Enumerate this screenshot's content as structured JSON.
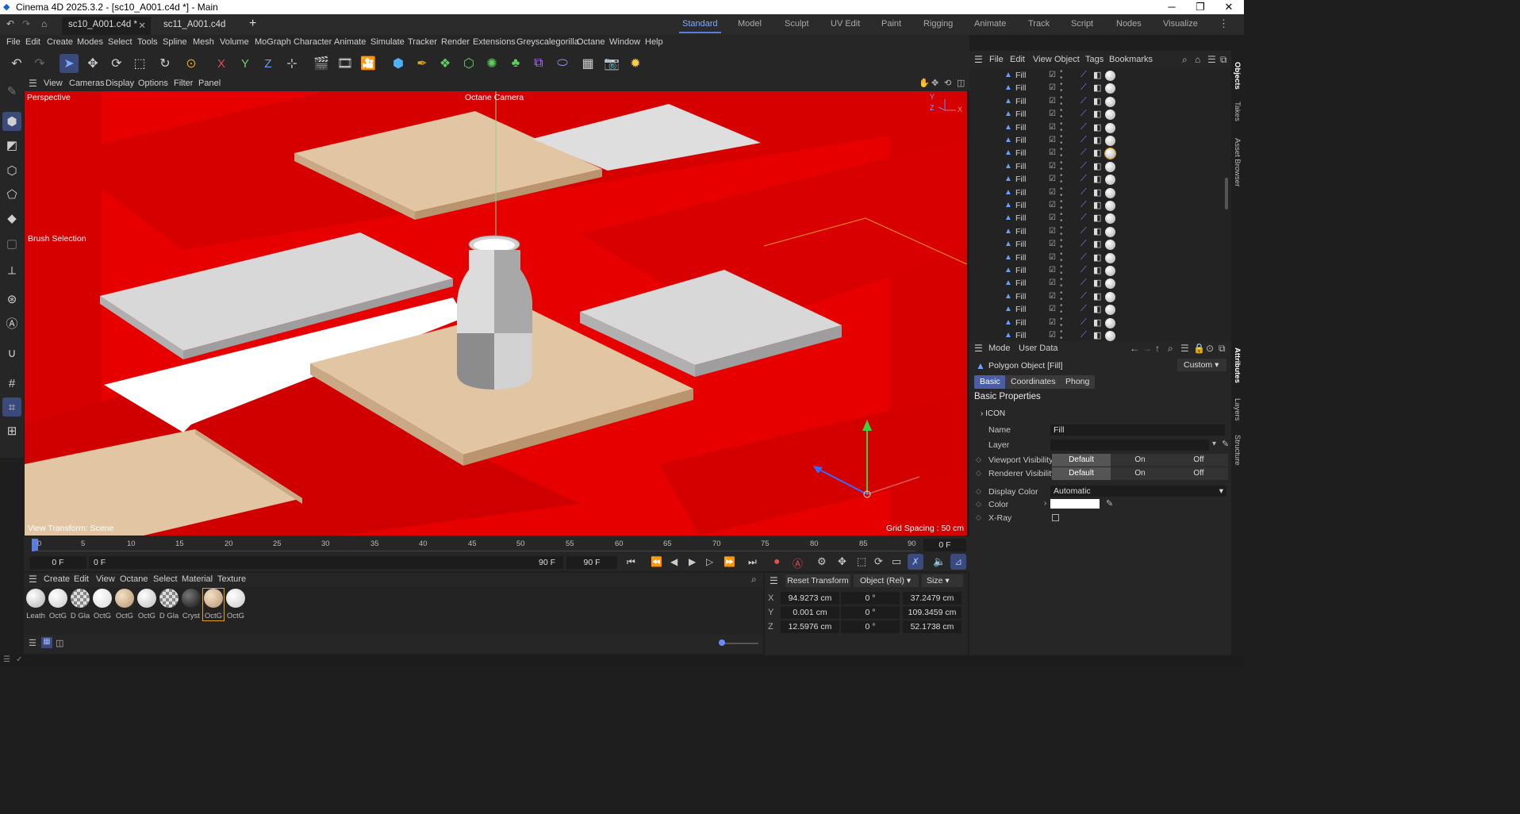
{
  "app": {
    "title": "Cinema 4D 2025.3.2 - [sc10_A001.c4d *] - Main"
  },
  "file_tabs": [
    {
      "label": "sc10_A001.c4d *"
    },
    {
      "label": "sc11_A001.c4d"
    }
  ],
  "layouts": [
    "Standard",
    "Model",
    "Sculpt",
    "UV Edit",
    "Paint",
    "Rigging",
    "Animate",
    "Track",
    "Script",
    "Nodes",
    "Visualize"
  ],
  "menus": [
    "File",
    "Edit",
    "Create",
    "Modes",
    "Select",
    "Tools",
    "Spline",
    "Mesh",
    "Volume",
    "MoGraph",
    "Character",
    "Animate",
    "Simulate",
    "Tracker",
    "Render",
    "Extensions",
    "Greyscalegorilla",
    "Octane",
    "Window",
    "Help"
  ],
  "toolbar": {
    "axes": [
      "X",
      "Y",
      "Z"
    ]
  },
  "viewport": {
    "menus": [
      "View",
      "Cameras",
      "Display",
      "Options",
      "Filter",
      "Panel"
    ],
    "view_name": "Perspective",
    "camera_label": "Octane Camera",
    "brush_label": "Brush Selection",
    "view_transform": "View Transform: Scene",
    "grid_spacing": "Grid Spacing : 50 cm",
    "axis_y": "Y",
    "axis_z": "Z",
    "axis_x": "X",
    "bg_color": "#e60000"
  },
  "timeline": {
    "ticks": [
      "0",
      "5",
      "10",
      "15",
      "20",
      "25",
      "30",
      "35",
      "40",
      "45",
      "50",
      "55",
      "60",
      "65",
      "70",
      "75",
      "80",
      "85",
      "90"
    ],
    "current": "0 F"
  },
  "playback": {
    "start": "0 F",
    "preview_start": "0 F",
    "preview_end": "90 F",
    "end": "90 F"
  },
  "materials": {
    "menus": [
      "Create",
      "Edit",
      "View",
      "Octane",
      "Select",
      "Material",
      "Texture"
    ],
    "items": [
      {
        "label": "Leath",
        "color": "#d8d8d8"
      },
      {
        "label": "OctG",
        "color": "#e2e2e2"
      },
      {
        "label": "D Gla",
        "color": "#bdbdbd"
      },
      {
        "label": "OctG",
        "color": "#f0f0f0"
      },
      {
        "label": "OctG",
        "color": "#d9c0a0"
      },
      {
        "label": "OctG",
        "color": "#d7d7d7"
      },
      {
        "label": "D Gla",
        "color": "#bdbdbd"
      },
      {
        "label": "Cryst",
        "color": "#2a2a2a"
      },
      {
        "label": "OctG",
        "color": "#d9c0a0"
      },
      {
        "label": "OctG",
        "color": "#e0e0e0"
      }
    ]
  },
  "coords": {
    "reset": "Reset Transform",
    "mode": "Object (Rel)",
    "size": "Size",
    "rows": [
      {
        "axis": "X",
        "pos": "94.9273 cm",
        "rot": "0 °",
        "size": "37.2479 cm"
      },
      {
        "axis": "Y",
        "pos": "0.001 cm",
        "rot": "0 °",
        "size": "109.3459 cm"
      },
      {
        "axis": "Z",
        "pos": "12.5976 cm",
        "rot": "0 °",
        "size": "52.1738 cm"
      }
    ]
  },
  "objects": {
    "menus": [
      "File",
      "Edit",
      "View",
      "Object",
      "Tags",
      "Bookmarks"
    ],
    "items": [
      "Fill",
      "Fill",
      "Fill",
      "Fill",
      "Fill",
      "Fill",
      "Fill",
      "Fill",
      "Fill",
      "Fill",
      "Fill",
      "Fill",
      "Fill",
      "Fill",
      "Fill",
      "Fill",
      "Fill",
      "Fill",
      "Fill",
      "Fill",
      "Fill"
    ]
  },
  "attributes": {
    "menus": [
      "Mode",
      "User Data"
    ],
    "object_title": "Polygon Object [Fill]",
    "preset": "Custom",
    "tabs": [
      "Basic",
      "Coordinates",
      "Phong"
    ],
    "section": "Basic Properties",
    "icon_group": "ICON",
    "name_label": "Name",
    "name_value": "Fill",
    "layer_label": "Layer",
    "viewport_vis_label": "Viewport Visibility",
    "renderer_vis_label": "Renderer Visibility",
    "vis_options": [
      "Default",
      "On",
      "Off"
    ],
    "display_color_label": "Display Color",
    "display_color_value": "Automatic",
    "color_label": "Color",
    "xray_label": "X-Ray"
  },
  "side_tabs": [
    "Objects",
    "Takes",
    "Asset Browser",
    "Attributes",
    "Layers",
    "Structure"
  ]
}
